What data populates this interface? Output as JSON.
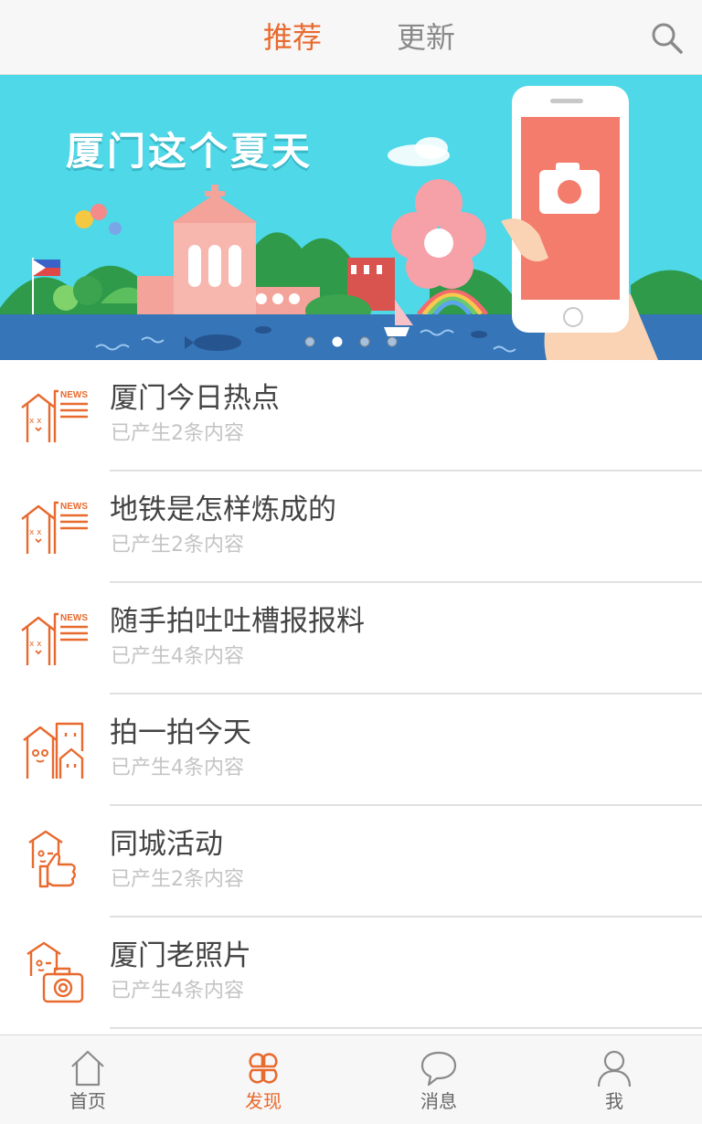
{
  "header": {
    "tabs": [
      {
        "label": "推荐",
        "active": true
      },
      {
        "label": "更新",
        "active": false
      }
    ],
    "search_icon": "search-icon"
  },
  "banner": {
    "title": "厦门这个夏天",
    "carousel_total": 4,
    "carousel_active_index": 1
  },
  "list": {
    "items": [
      {
        "title": "厦门今日热点",
        "subtitle": "已产生2条内容",
        "icon": "news-house-icon"
      },
      {
        "title": "地铁是怎样炼成的",
        "subtitle": "已产生2条内容",
        "icon": "news-house-icon"
      },
      {
        "title": "随手拍吐吐槽报报料",
        "subtitle": "已产生4条内容",
        "icon": "news-house-icon"
      },
      {
        "title": "拍一拍今天",
        "subtitle": "已产生4条内容",
        "icon": "houses-icon"
      },
      {
        "title": "同城活动",
        "subtitle": "已产生2条内容",
        "icon": "thumbs-up-house-icon"
      },
      {
        "title": "厦门老照片",
        "subtitle": "已产生4条内容",
        "icon": "camera-house-icon"
      }
    ]
  },
  "bottom_nav": {
    "items": [
      {
        "label": "首页",
        "icon": "home-icon",
        "active": false
      },
      {
        "label": "发现",
        "icon": "discover-icon",
        "active": true
      },
      {
        "label": "消息",
        "icon": "message-icon",
        "active": false
      },
      {
        "label": "我",
        "icon": "user-icon",
        "active": false
      }
    ]
  },
  "colors": {
    "accent": "#e86a2e",
    "text": "#444444",
    "subtext": "#c4c4c4",
    "inactive": "#8a8a8a",
    "banner_bg": "#4ed8e8"
  }
}
